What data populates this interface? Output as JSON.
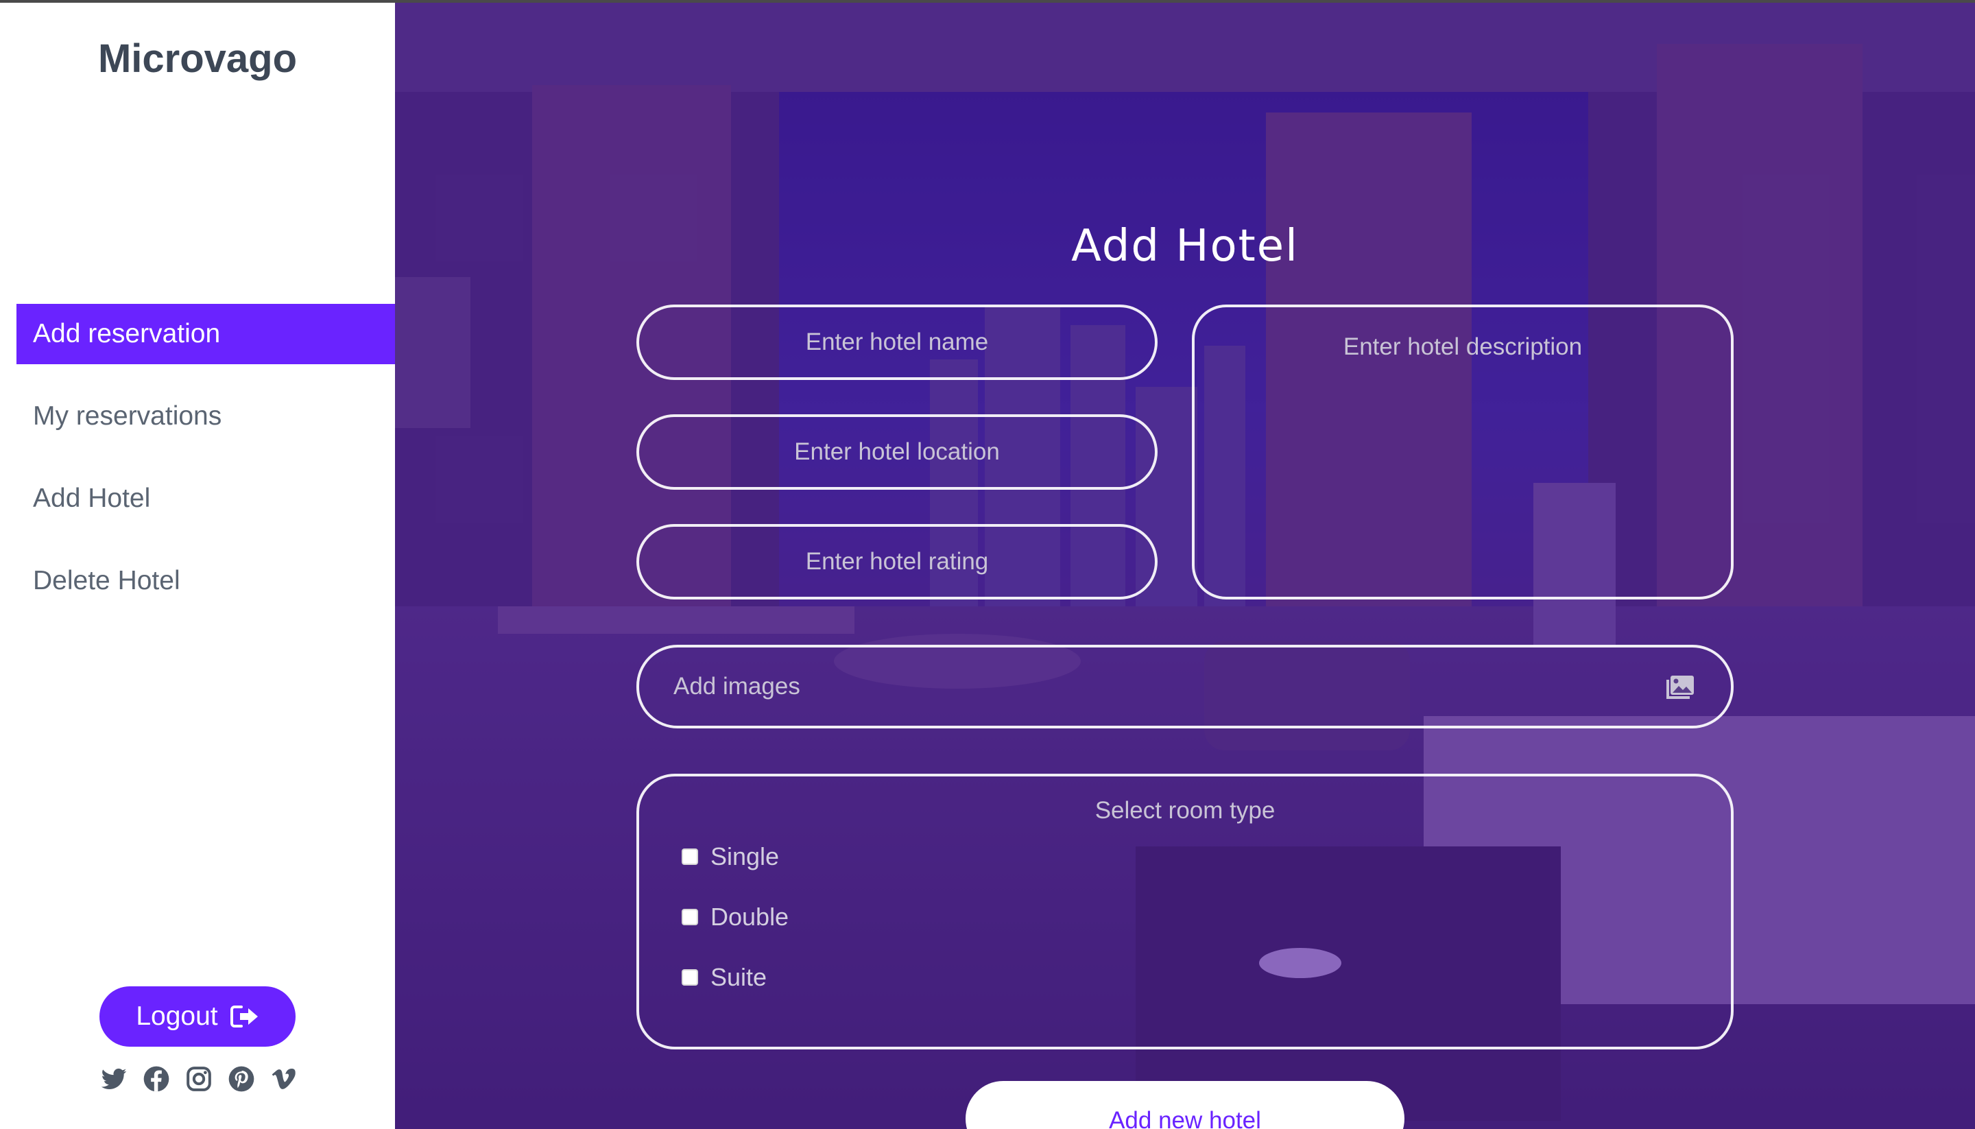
{
  "brand": "Microvago",
  "nav": [
    {
      "label": "Add reservation",
      "active": true
    },
    {
      "label": "My reservations",
      "active": false
    },
    {
      "label": "Add Hotel",
      "active": false
    },
    {
      "label": "Delete Hotel",
      "active": false
    }
  ],
  "logout_label": "Logout",
  "social": [
    "twitter-icon",
    "facebook-icon",
    "instagram-icon",
    "pinterest-icon",
    "vimeo-icon"
  ],
  "form": {
    "title": "Add Hotel",
    "name_placeholder": "Enter hotel name",
    "location_placeholder": "Enter hotel location",
    "rating_placeholder": "Enter hotel rating",
    "description_placeholder": "Enter hotel description",
    "images_label": "Add images",
    "room_type_label": "Select room type",
    "room_types": [
      "Single",
      "Double",
      "Suite"
    ],
    "submit_label": "Add new hotel"
  },
  "colors": {
    "accent": "#6a23ff",
    "overlay": "#521aaa",
    "sidebar_text": "#5a6472"
  }
}
